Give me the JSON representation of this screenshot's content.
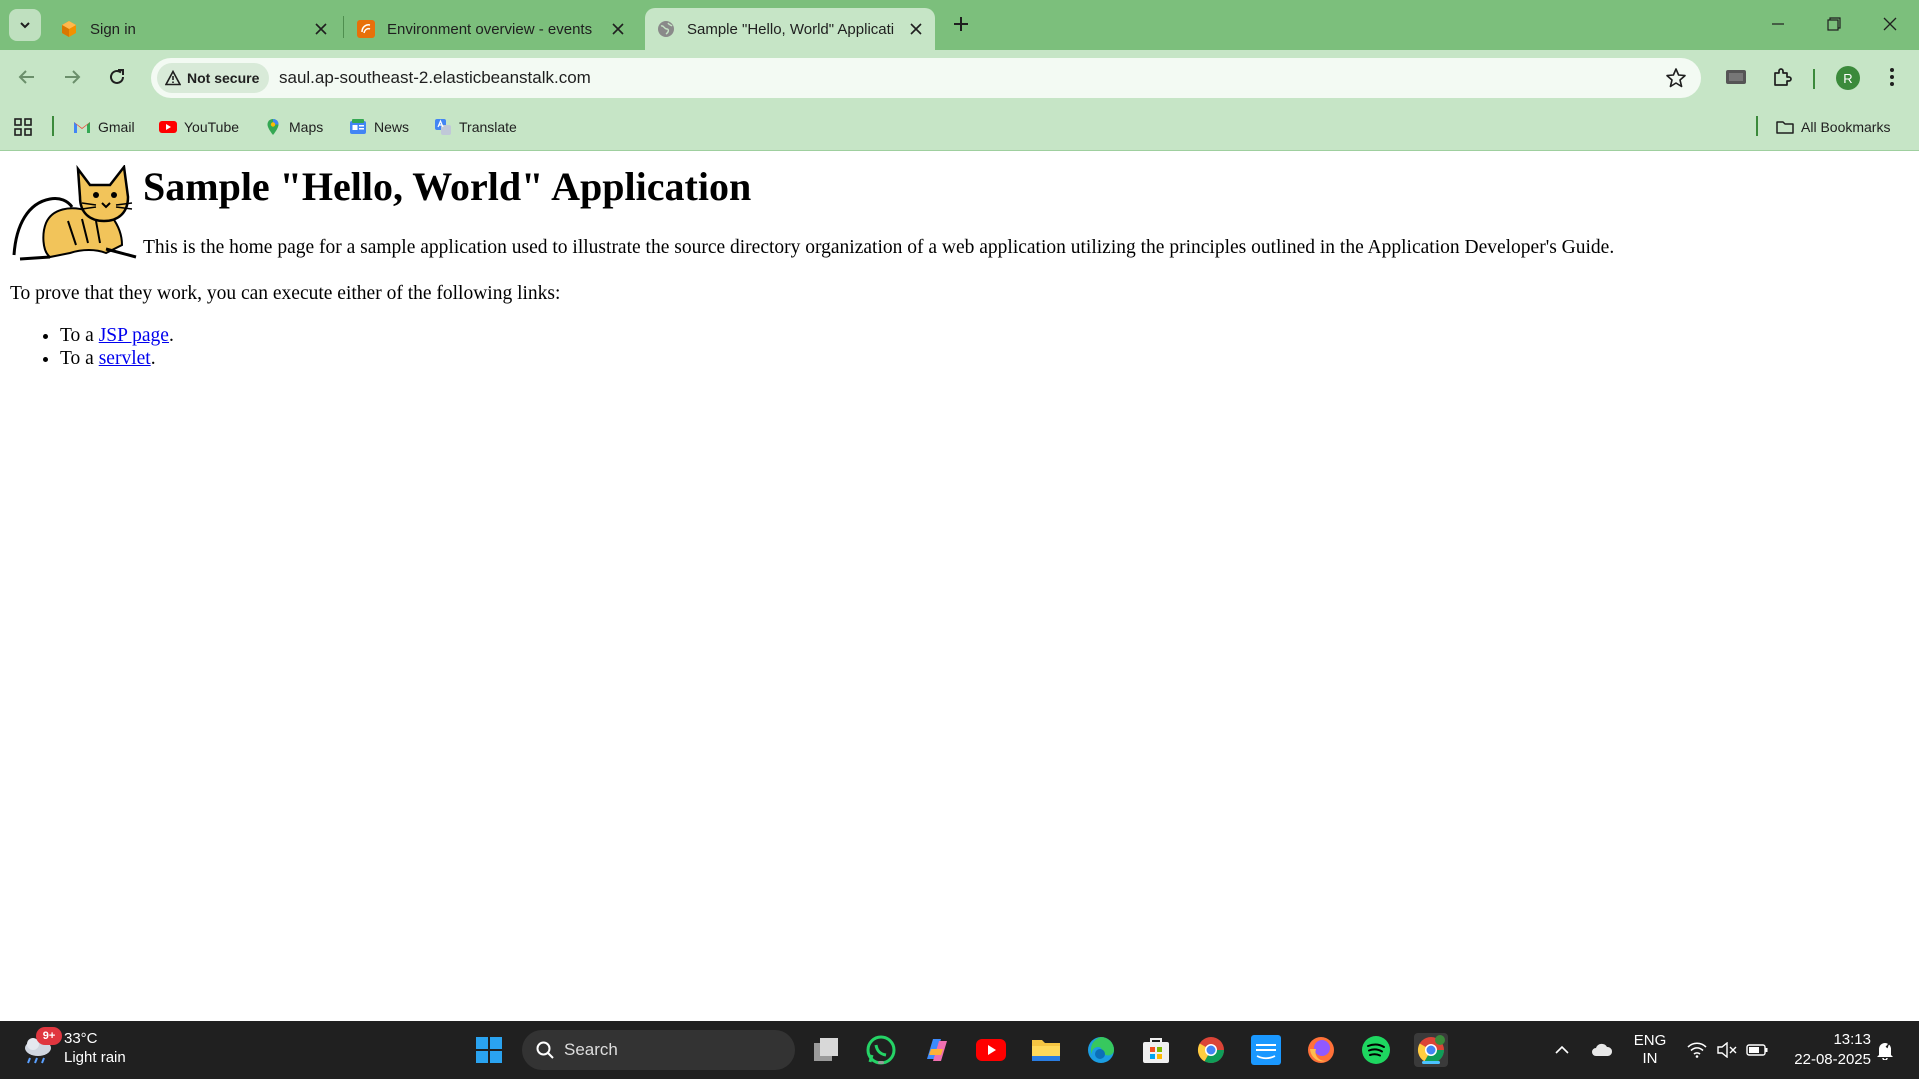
{
  "browser": {
    "tabs": [
      {
        "title": "Sign in",
        "favicon": "aws-cube-icon"
      },
      {
        "title": "Environment overview - events",
        "favicon": "elastic-beanstalk-icon"
      },
      {
        "title": "Sample \"Hello, World\" Applicati",
        "favicon": "globe-icon",
        "active": true
      }
    ],
    "security_label": "Not secure",
    "url": "saul.ap-southeast-2.elasticbeanstalk.com",
    "profile_initial": "R"
  },
  "bookmarks": {
    "items": [
      {
        "label": "Gmail",
        "icon": "gmail-icon"
      },
      {
        "label": "YouTube",
        "icon": "youtube-icon"
      },
      {
        "label": "Maps",
        "icon": "maps-icon"
      },
      {
        "label": "News",
        "icon": "news-icon"
      },
      {
        "label": "Translate",
        "icon": "translate-icon"
      }
    ],
    "all_bookmarks": "All Bookmarks"
  },
  "page": {
    "heading": "Sample \"Hello, World\" Application",
    "intro": "This is the home page for a sample application used to illustrate the source directory organization of a web application utilizing the principles outlined in the Application Developer's Guide.",
    "prove": "To prove that they work, you can execute either of the following links:",
    "links": [
      {
        "prefix": "To a ",
        "link": "JSP page",
        "suffix": "."
      },
      {
        "prefix": "To a ",
        "link": "servlet",
        "suffix": "."
      }
    ]
  },
  "taskbar": {
    "weather_temp": "33°C",
    "weather_desc": "Light rain",
    "weather_badge": "9+",
    "search_placeholder": "Search",
    "lang_top": "ENG",
    "lang_bottom": "IN",
    "time": "13:13",
    "date": "22-08-2025"
  },
  "colors": {
    "tab_strip": "#7cbf7c",
    "toolbar": "#c6e5c6",
    "link": "#0000ee",
    "taskbar": "#202020"
  }
}
